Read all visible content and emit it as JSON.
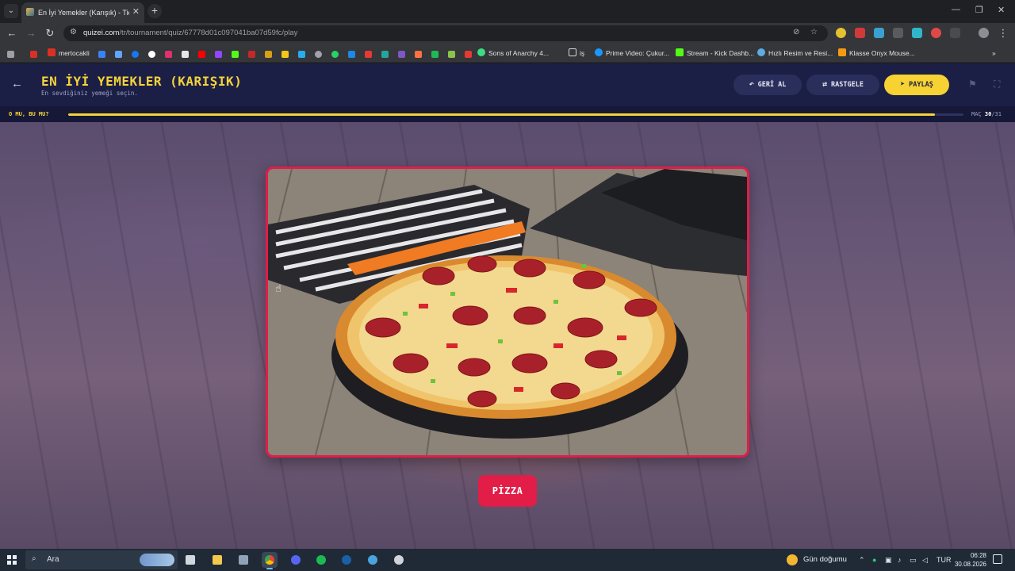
{
  "browser": {
    "tab_title": "En İyi Yemekler (Karışık) - Tier L",
    "url_host": "quizei.com",
    "url_path": "/tr/tournament/quiz/67778d01c097041ba07d59fc/play",
    "bookmarks": [
      {
        "label": "mertocakli"
      },
      {
        "label": "Sons of Anarchy 4..."
      },
      {
        "label": "iş"
      },
      {
        "label": "Prime Video: Çukur..."
      },
      {
        "label": "Stream - Kick Dashb..."
      },
      {
        "label": "Hızlı Resim ve Resi..."
      },
      {
        "label": "Klasse Onyx Mouse..."
      }
    ]
  },
  "header": {
    "title": "EN İYİ YEMEKLER (KARIŞIK)",
    "subtitle": "En sevdiğiniz yemeği seçin.",
    "undo_label": "GERİ AL",
    "random_label": "RASTGELE",
    "share_label": "PAYLAŞ"
  },
  "progress": {
    "label": "O MU, BU MU?",
    "match_label": "MAÇ",
    "current": "30",
    "separator": "/",
    "total": "31",
    "fraction": 0.9677
  },
  "match": {
    "answer_label": "PİZZA"
  },
  "taskbar": {
    "search_placeholder": "Ara",
    "weather": "Gün doğumu",
    "lang": "TUR",
    "time": "06:28",
    "date": "30.08.2026"
  },
  "colors": {
    "accent_yellow": "#f5d33a",
    "accent_red": "#e11d48",
    "header_bg": "#1c1f45"
  }
}
